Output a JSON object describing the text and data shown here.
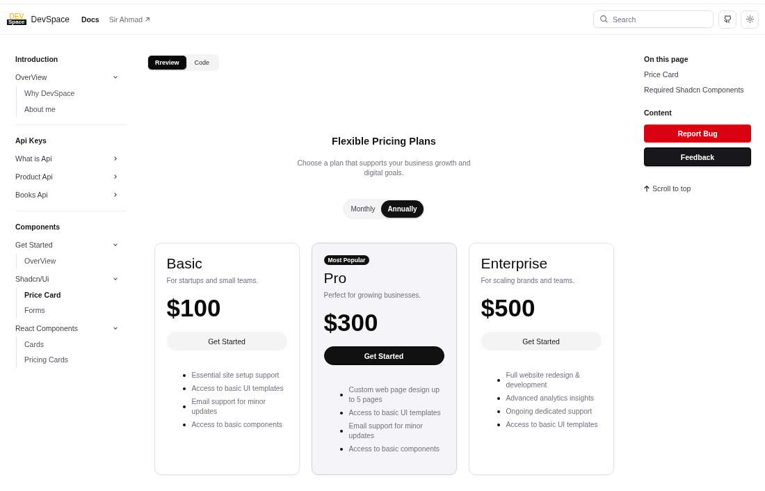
{
  "header": {
    "logo": {
      "top": "DEV",
      "bottom": "Space"
    },
    "brand": "DevSpace",
    "nav": [
      {
        "label": "Docs",
        "selected": true,
        "external": false
      },
      {
        "label": "Sir Ahmad",
        "selected": false,
        "external": true
      }
    ],
    "search": {
      "placeholder": "Search"
    }
  },
  "sidebar": {
    "sections": [
      {
        "title": "Introduction",
        "items": [
          {
            "label": "OverView",
            "expanded": true,
            "children": [
              {
                "label": "Why DevSpace",
                "selected": false
              },
              {
                "label": "About me",
                "selected": false
              }
            ]
          }
        ]
      },
      {
        "title": "Api Keys",
        "items": [
          {
            "label": "What is Api",
            "expanded": false
          },
          {
            "label": "Product Api",
            "expanded": false
          },
          {
            "label": "Books Api",
            "expanded": false
          }
        ]
      },
      {
        "title": "Components",
        "items": [
          {
            "label": "Get Started",
            "expanded": true,
            "children": [
              {
                "label": "OverView",
                "selected": false
              }
            ]
          },
          {
            "label": "Shadcn/Ui",
            "expanded": true,
            "children": [
              {
                "label": "Price Card",
                "selected": true
              },
              {
                "label": "Forms",
                "selected": false
              }
            ]
          },
          {
            "label": "React Components",
            "expanded": true,
            "children": [
              {
                "label": "Cards",
                "selected": false
              },
              {
                "label": "Pricing Cards",
                "selected": false
              }
            ]
          }
        ]
      }
    ]
  },
  "view_tabs": [
    {
      "label": "Rreview",
      "selected": true
    },
    {
      "label": "Code",
      "selected": false
    }
  ],
  "pricing": {
    "title": "Flexible Pricing Plans",
    "subtitle": "Choose a plan that supports your business growth and digital goals.",
    "billing": [
      {
        "label": "Monthly",
        "selected": false
      },
      {
        "label": "Annually",
        "selected": true
      }
    ],
    "plans": [
      {
        "name": "Basic",
        "description": "For startups and small teams.",
        "price": "$100",
        "button": "Get Started",
        "featured": false,
        "features": [
          "Essential site setup support",
          "Access to basic UI templates",
          "Email support for minor updates",
          "Access to basic components"
        ]
      },
      {
        "badge": "Most Popular",
        "name": "Pro",
        "description": "Perfect for growing businesses.",
        "price": "$300",
        "button": "Get Started",
        "featured": true,
        "features": [
          "Custom web page design up to 5 pages",
          "Access to basic UI templates",
          "Email support for minor updates",
          "Access to basic components"
        ]
      },
      {
        "name": "Enterprise",
        "description": "For scaling brands and teams.",
        "price": "$500",
        "button": "Get Started",
        "featured": false,
        "features": [
          "Full website redesign & development",
          "Advanced analytics insights",
          "Ongoing dedicated support",
          "Access to basic UI templates"
        ]
      }
    ]
  },
  "toc": {
    "title": "On this page",
    "links": [
      "Price Card",
      "Required Shadcn Components"
    ]
  },
  "content": {
    "title": "Content",
    "buttons": [
      {
        "label": "Report Bug",
        "kind": "danger"
      },
      {
        "label": "Feedback",
        "kind": "primary"
      }
    ]
  },
  "scroll_top": {
    "label": "Scroll to top"
  }
}
